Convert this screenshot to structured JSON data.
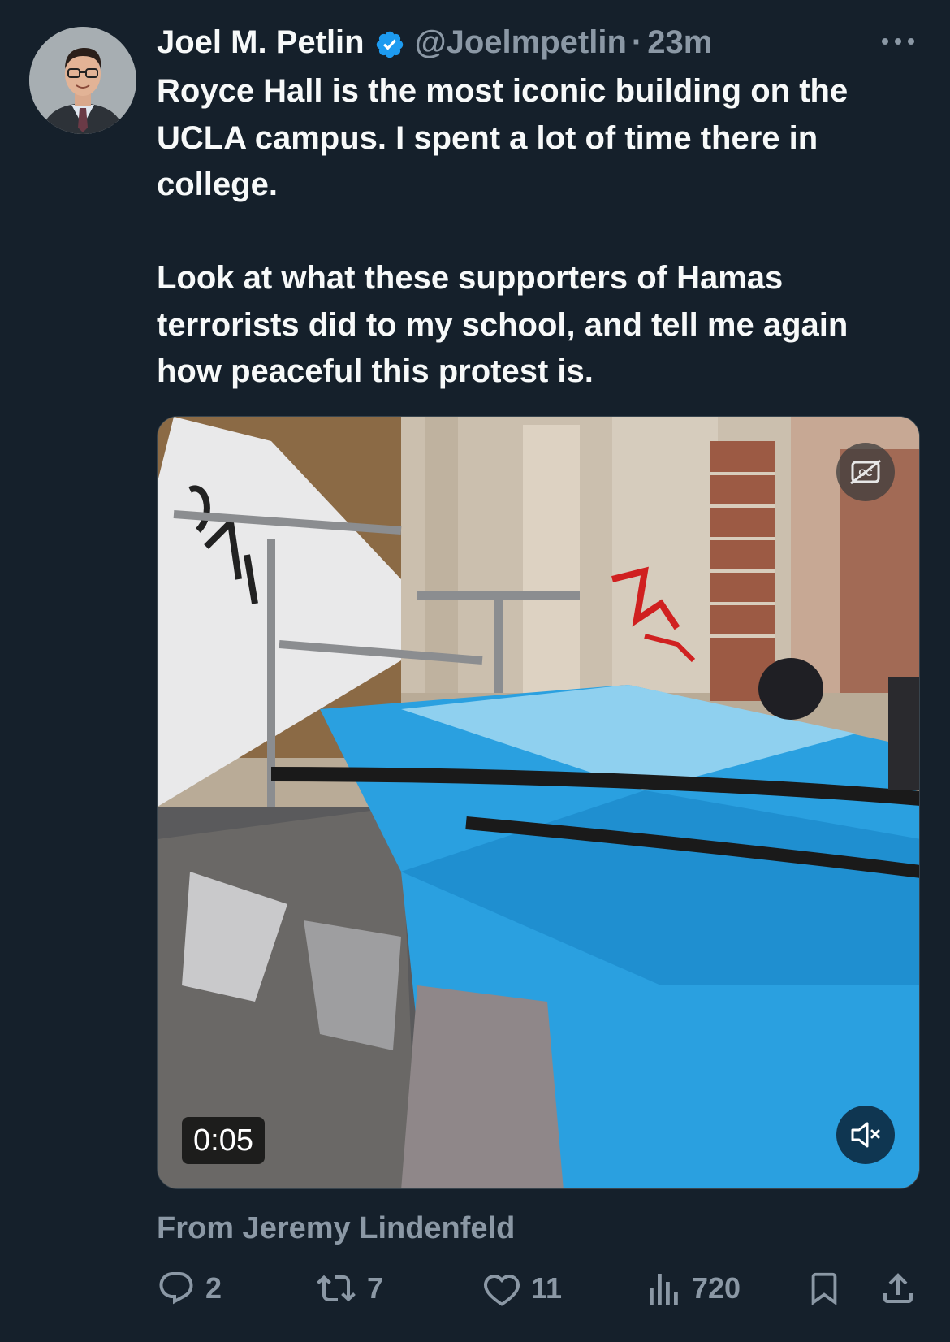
{
  "tweet": {
    "author": {
      "display_name": "Joel M. Petlin",
      "handle": "@Joelmpetlin",
      "verified_icon": "verified-badge-icon"
    },
    "separator": "·",
    "time": "23m",
    "text_paragraphs": [
      "Royce Hall is the most iconic building on the UCLA campus. I spent a lot of time there in college.",
      "Look at what these supporters of Hamas terrorists did to my school, and tell me again how peaceful this protest is."
    ],
    "media": {
      "type": "video",
      "duration": "0:05",
      "captions_icon": "captions-off-icon",
      "volume_icon": "muted-speaker-icon"
    },
    "attribution": "From Jeremy Lindenfeld",
    "metrics": {
      "replies": "2",
      "reposts": "7",
      "likes": "11",
      "views": "720"
    }
  },
  "colors": {
    "background": "#15202b",
    "text_primary": "#f7f9f9",
    "text_secondary": "#8b98a5",
    "verified_blue": "#1d9bf0"
  }
}
